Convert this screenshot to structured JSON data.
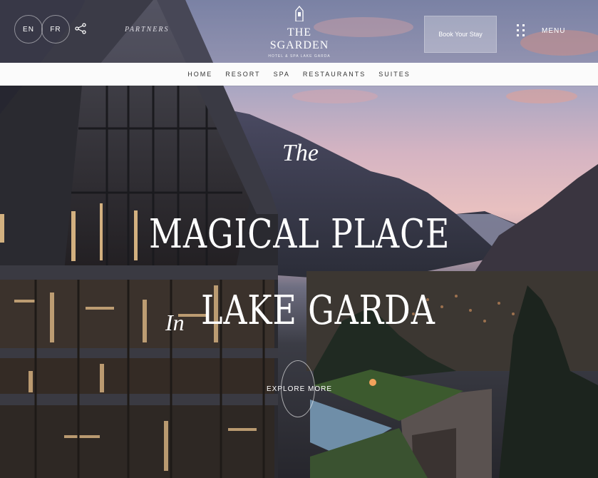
{
  "topbar": {
    "lang_en": "EN",
    "lang_fr": "FR",
    "share_icon": "share-icon",
    "brand_mark": "PARTNERS",
    "logo_name": "THE SGARDEN",
    "logo_sub": "HOTEL & SPA LAKE GARDA",
    "book_label": "Book Your Stay",
    "menu_label": "MENU"
  },
  "nav": {
    "items": [
      "HOME",
      "RESORT",
      "SPA",
      "RESTAURANTS",
      "SUITES"
    ]
  },
  "hero": {
    "the": "The",
    "line1": "MAGICAL PLACE",
    "in": "In",
    "line2": "LAKE GARDA",
    "explore": "EXPLORE MORE"
  },
  "colors": {
    "sky_top": "#7e88ad",
    "sky_glow": "#e8c0c0",
    "building": "#2a2a30",
    "nav_bg": "#fbfbfb",
    "lawn": "#3c5a2e"
  }
}
